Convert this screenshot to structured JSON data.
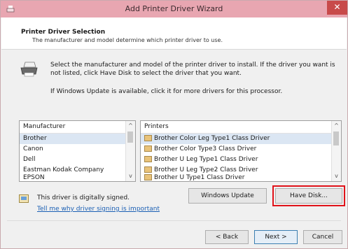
{
  "window": {
    "title": "Add Printer Driver Wizard",
    "close_label": "✕"
  },
  "header": {
    "title": "Printer Driver Selection",
    "subtitle": "The manufacturer and model determine which printer driver to use."
  },
  "intro": {
    "line1": "Select the manufacturer and model of the printer driver to install. If the driver you want is not listed, click Have Disk to select the driver that you want.",
    "line2": "If Windows Update is available, click it for more drivers for this processor."
  },
  "manufacturer_list": {
    "header": "Manufacturer",
    "items": [
      "Brother",
      "Canon",
      "Dell",
      "Eastman Kodak Company",
      "EPSON"
    ]
  },
  "printers_list": {
    "header": "Printers",
    "items": [
      "Brother Color Leg Type1 Class Driver",
      "Brother Color Type3 Class Driver",
      "Brother U Leg Type1 Class Driver",
      "Brother U Leg Type2 Class Driver",
      "Brother U Type1 Class Driver"
    ]
  },
  "signing": {
    "text": "This driver is digitally signed.",
    "link": "Tell me why driver signing is important"
  },
  "buttons": {
    "windows_update": "Windows Update",
    "have_disk": "Have Disk...",
    "back": "< Back",
    "next": "Next >",
    "cancel": "Cancel"
  }
}
